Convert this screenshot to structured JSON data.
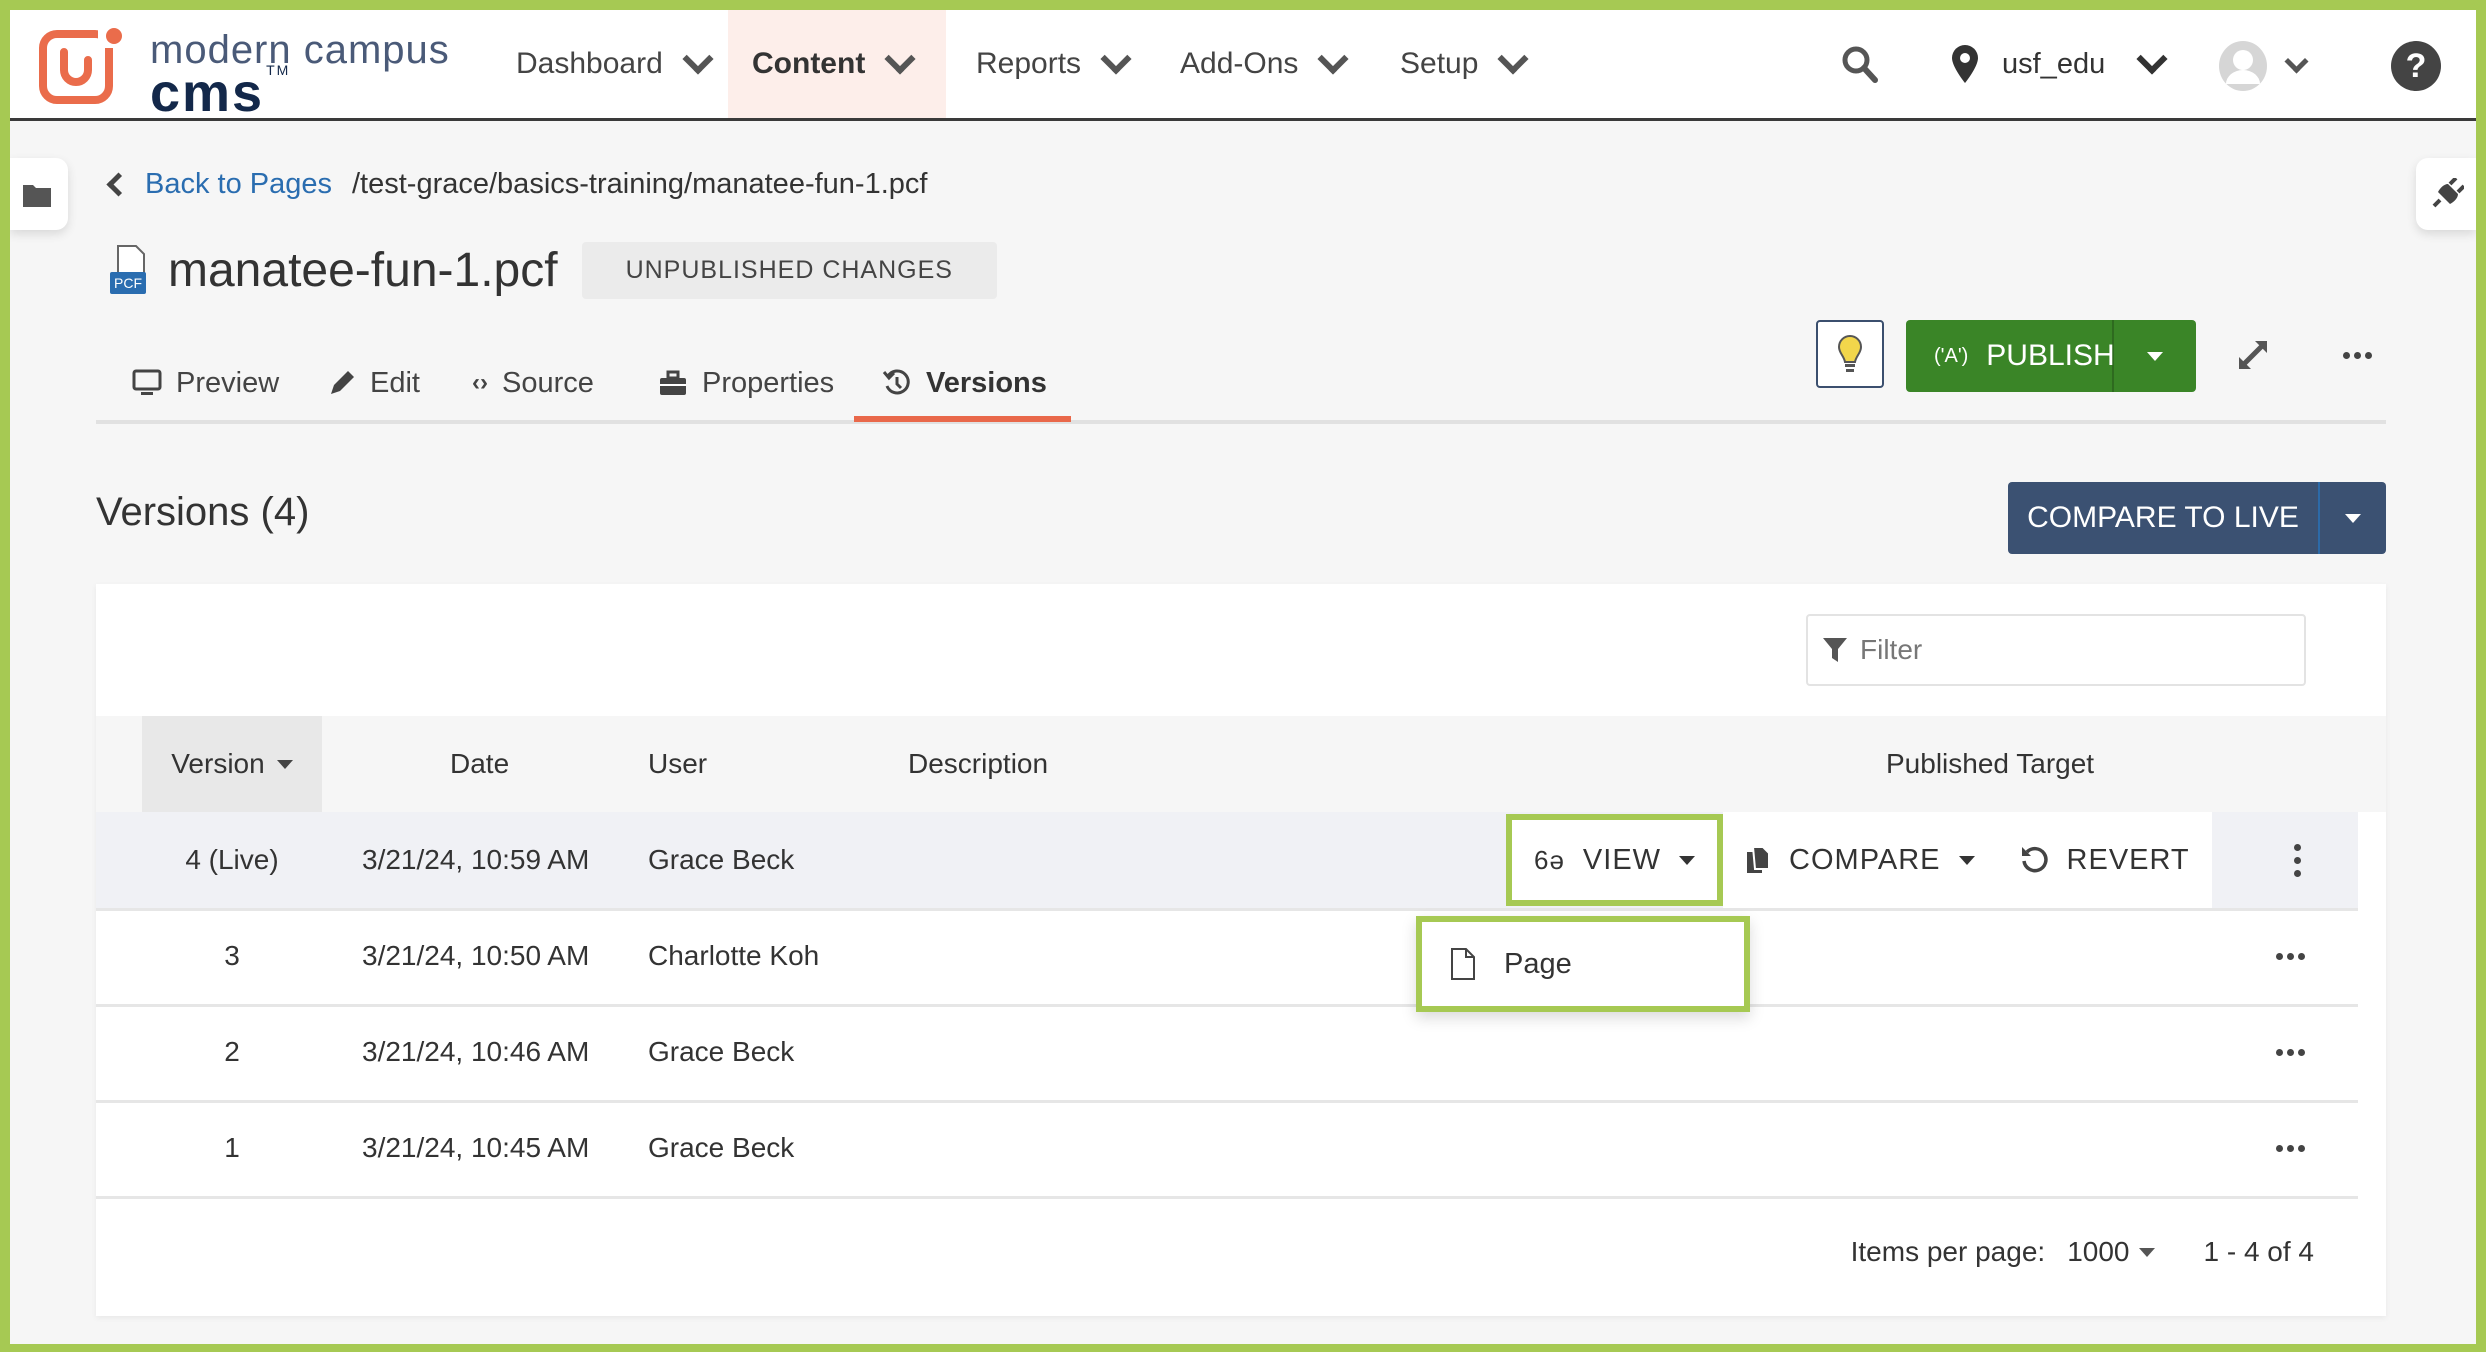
{
  "brand": {
    "line1": "modern campus",
    "line2": "cms",
    "tm": "TM",
    "accent": "#ea6c4b",
    "frame_color": "#a6c953"
  },
  "nav": {
    "items": [
      {
        "label": "Dashboard",
        "active": false
      },
      {
        "label": "Content",
        "active": true
      },
      {
        "label": "Reports",
        "active": false
      },
      {
        "label": "Add-Ons",
        "active": false
      },
      {
        "label": "Setup",
        "active": false
      }
    ],
    "site": "usf_edu"
  },
  "breadcrumb": {
    "back_label": "Back to Pages",
    "path": "/test-grace/basics-training/manatee-fun-1.pcf"
  },
  "file": {
    "name": "manatee-fun-1.pcf",
    "type_badge": "PCF",
    "status": "UNPUBLISHED CHANGES"
  },
  "tabs": [
    {
      "label": "Preview"
    },
    {
      "label": "Edit"
    },
    {
      "label": "Source"
    },
    {
      "label": "Properties"
    },
    {
      "label": "Versions",
      "active": true
    }
  ],
  "actions": {
    "publish_label": "PUBLISH",
    "publish_color": "#3a8527"
  },
  "versions": {
    "title": "Versions (4)",
    "compare_to_live_label": "COMPARE TO LIVE",
    "filter_placeholder": "Filter",
    "columns": [
      "Version",
      "Date",
      "User",
      "Description",
      "Published Target"
    ],
    "rows": [
      {
        "version": "4 (Live)",
        "date": "3/21/24, 10:59 AM",
        "user": "Grace Beck",
        "description": "",
        "target": ""
      },
      {
        "version": "3",
        "date": "3/21/24, 10:50 AM",
        "user": "Charlotte Koh",
        "description": "",
        "target": ""
      },
      {
        "version": "2",
        "date": "3/21/24, 10:46 AM",
        "user": "Grace Beck",
        "description": "",
        "target": ""
      },
      {
        "version": "1",
        "date": "3/21/24, 10:45 AM",
        "user": "Grace Beck",
        "description": "",
        "target": ""
      }
    ],
    "row_actions": {
      "view": "VIEW",
      "compare": "COMPARE",
      "revert": "REVERT"
    },
    "view_menu": [
      {
        "label": "Page"
      }
    ],
    "pagination": {
      "items_per_page_label": "Items per page:",
      "items_per_page": "1000",
      "range": "1 - 4 of 4"
    }
  }
}
